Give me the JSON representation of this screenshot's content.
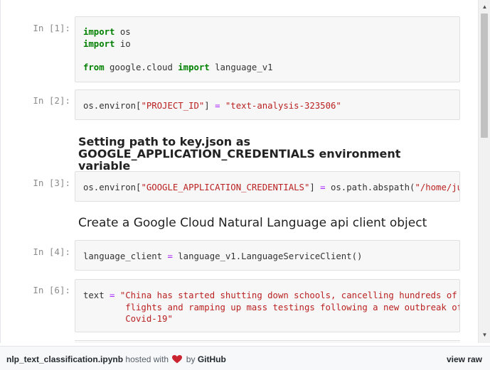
{
  "notebook": {
    "cells": [
      {
        "prompt": "In [1]:",
        "lines": [
          [
            {
              "t": "import",
              "c": "kw"
            },
            {
              "t": " os",
              "c": ""
            }
          ],
          [
            {
              "t": "import",
              "c": "kw"
            },
            {
              "t": " io",
              "c": ""
            }
          ],
          [],
          [
            {
              "t": "from",
              "c": "kw"
            },
            {
              "t": " google.cloud ",
              "c": ""
            },
            {
              "t": "import",
              "c": "kw"
            },
            {
              "t": " language_v1",
              "c": ""
            }
          ]
        ]
      },
      {
        "prompt": "In [2]:",
        "lines": [
          [
            {
              "t": "os.environ[",
              "c": ""
            },
            {
              "t": "\"PROJECT_ID\"",
              "c": "str"
            },
            {
              "t": "] ",
              "c": ""
            },
            {
              "t": "=",
              "c": "op"
            },
            {
              "t": " ",
              "c": ""
            },
            {
              "t": "\"text-analysis-323506\"",
              "c": "str"
            }
          ]
        ]
      },
      {
        "prompt": "In [3]:",
        "lines": [
          [
            {
              "t": "os.environ[",
              "c": ""
            },
            {
              "t": "\"GOOGLE_APPLICATION_CREDENTIALS\"",
              "c": "str"
            },
            {
              "t": "] ",
              "c": ""
            },
            {
              "t": "=",
              "c": "op"
            },
            {
              "t": " os.path.abspath(",
              "c": ""
            },
            {
              "t": "\"/home/jupyter/key.json\"",
              "c": "str"
            },
            {
              "t": ")",
              "c": ""
            }
          ]
        ]
      },
      {
        "prompt": "In [4]:",
        "lines": [
          [
            {
              "t": "language_client ",
              "c": ""
            },
            {
              "t": "=",
              "c": "op"
            },
            {
              "t": " language_v1.LanguageServiceClient()",
              "c": ""
            }
          ]
        ]
      },
      {
        "prompt": "In [6]:",
        "lines": [
          [
            {
              "t": "text ",
              "c": ""
            },
            {
              "t": "=",
              "c": "op"
            },
            {
              "t": " ",
              "c": ""
            },
            {
              "t": "\"China has started shutting down schools, cancelling hundreds of \\",
              "c": "str"
            }
          ],
          [
            {
              "t": "        flights and ramping up mass testings following a new outbreak of \\",
              "c": "str"
            }
          ],
          [
            {
              "t": "        Covid-19\"",
              "c": "str"
            }
          ]
        ]
      }
    ],
    "headings": {
      "credentials": "Setting path to key.json as GOOGLE_APPLICATION_CREDENTIALS environment variable",
      "client": "Create a Google Cloud Natural Language api client object"
    }
  },
  "footer": {
    "filename": "nlp_text_classification.ipynb",
    "hosted_with": "hosted with",
    "by": "by",
    "brand": "GitHub",
    "view_raw": "view raw"
  },
  "colors": {
    "keyword": "#008000",
    "string": "#ba2121",
    "operator": "#aa22ff",
    "heart": "#cb2431"
  }
}
